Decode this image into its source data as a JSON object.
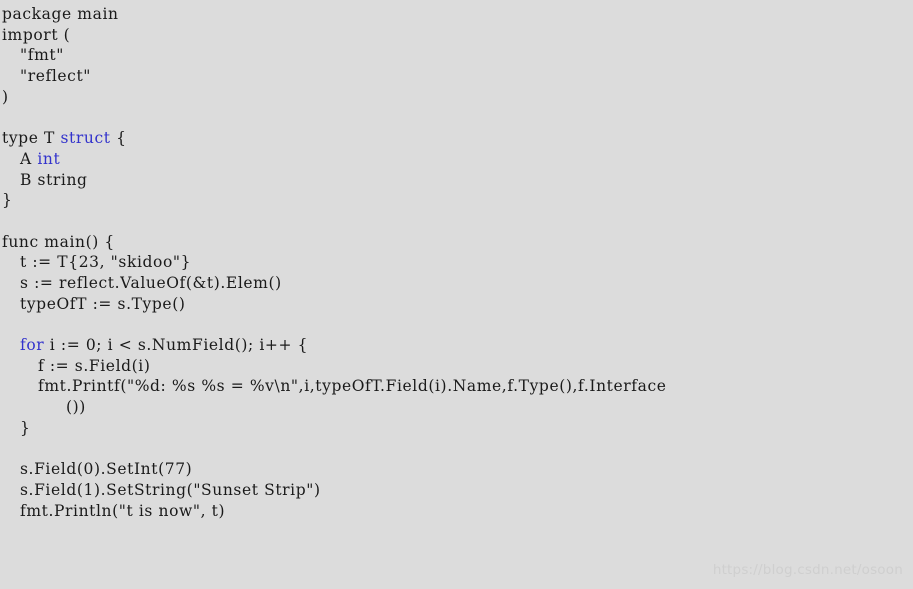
{
  "document": {
    "language": "Go",
    "background_color": "#dcdcdc",
    "text_color": "#1a1a1a",
    "keyword_color": "#3333cc"
  },
  "code": {
    "lines": [
      {
        "indent": 0,
        "segments": [
          {
            "text": "package main",
            "kind": "plain"
          }
        ]
      },
      {
        "indent": 0,
        "segments": [
          {
            "text": "import (",
            "kind": "plain"
          }
        ]
      },
      {
        "indent": 1,
        "segments": [
          {
            "text": "\"fmt\"",
            "kind": "plain"
          }
        ]
      },
      {
        "indent": 1,
        "segments": [
          {
            "text": "\"reflect\"",
            "kind": "plain"
          }
        ]
      },
      {
        "indent": 0,
        "segments": [
          {
            "text": ")",
            "kind": "plain"
          }
        ]
      },
      {
        "indent": 0,
        "segments": [
          {
            "text": "",
            "kind": "plain"
          }
        ]
      },
      {
        "indent": 0,
        "segments": [
          {
            "text": "type T ",
            "kind": "plain"
          },
          {
            "text": "struct",
            "kind": "keyword"
          },
          {
            "text": " {",
            "kind": "plain"
          }
        ]
      },
      {
        "indent": 1,
        "segments": [
          {
            "text": "A ",
            "kind": "plain"
          },
          {
            "text": "int",
            "kind": "keyword"
          }
        ]
      },
      {
        "indent": 1,
        "segments": [
          {
            "text": "B string",
            "kind": "plain"
          }
        ]
      },
      {
        "indent": 0,
        "segments": [
          {
            "text": "}",
            "kind": "plain"
          }
        ]
      },
      {
        "indent": 0,
        "segments": [
          {
            "text": "",
            "kind": "plain"
          }
        ]
      },
      {
        "indent": 0,
        "segments": [
          {
            "text": "func main() {",
            "kind": "plain"
          }
        ]
      },
      {
        "indent": 1,
        "segments": [
          {
            "text": "t := T{23, \"skidoo\"}",
            "kind": "plain"
          }
        ]
      },
      {
        "indent": 1,
        "segments": [
          {
            "text": "s := reflect.ValueOf(&t).Elem()",
            "kind": "plain"
          }
        ]
      },
      {
        "indent": 1,
        "segments": [
          {
            "text": "typeOfT := s.Type()",
            "kind": "plain"
          }
        ]
      },
      {
        "indent": 0,
        "segments": [
          {
            "text": "",
            "kind": "plain"
          }
        ]
      },
      {
        "indent": 1,
        "segments": [
          {
            "text": "for",
            "kind": "keyword"
          },
          {
            "text": " i := 0; i < s.NumField(); i++ {",
            "kind": "plain"
          }
        ]
      },
      {
        "indent": 2,
        "segments": [
          {
            "text": "f := s.Field(i)",
            "kind": "plain"
          }
        ]
      },
      {
        "indent": 2,
        "segments": [
          {
            "text": "fmt.Printf(\"%d: %s %s = %v\\n\",i,typeOfT.Field(i).Name,f.Type(),f.Interface",
            "kind": "plain"
          }
        ]
      },
      {
        "indent": 3,
        "segments": [
          {
            "text": "())",
            "kind": "plain"
          }
        ]
      },
      {
        "indent": 1,
        "segments": [
          {
            "text": "}",
            "kind": "plain"
          }
        ]
      },
      {
        "indent": 0,
        "segments": [
          {
            "text": "",
            "kind": "plain"
          }
        ]
      },
      {
        "indent": 1,
        "segments": [
          {
            "text": "s.Field(0).SetInt(77)",
            "kind": "plain"
          }
        ]
      },
      {
        "indent": 1,
        "segments": [
          {
            "text": "s.Field(1).SetString(\"Sunset Strip\")",
            "kind": "plain"
          }
        ]
      },
      {
        "indent": 1,
        "segments": [
          {
            "text": "fmt.Println(\"t is now\", t)",
            "kind": "plain"
          }
        ]
      }
    ]
  },
  "watermark": {
    "text": "https://blog.csdn.net/osoon",
    "color": "#cfcfcf"
  }
}
